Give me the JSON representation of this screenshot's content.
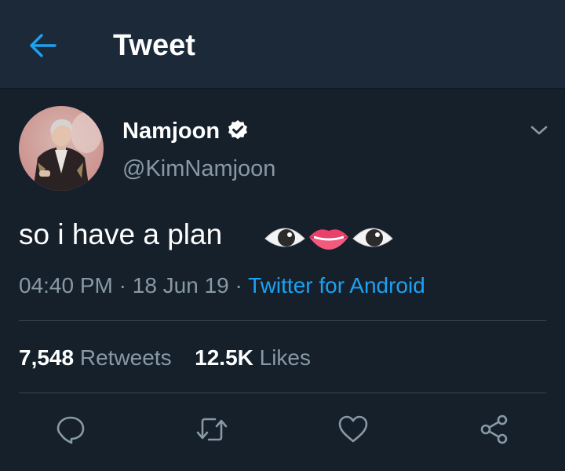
{
  "header": {
    "back_icon": "arrow-left-icon",
    "title": "Tweet"
  },
  "tweet": {
    "author": {
      "display_name": "Namjoon",
      "verified": true,
      "handle": "@KimNamjoon"
    },
    "text": "so i have a plan",
    "emojis": [
      "eye-emoji",
      "lips-emoji",
      "eye-emoji"
    ],
    "time": "04:40 PM",
    "sep1": "·",
    "date": "18 Jun 19",
    "sep2": "·",
    "source": "Twitter for Android",
    "stats": {
      "retweets_count": "7,548",
      "retweets_label": "Retweets",
      "likes_count": "12.5K",
      "likes_label": "Likes"
    },
    "actions": [
      "reply-icon",
      "retweet-icon",
      "like-icon",
      "share-icon"
    ]
  },
  "colors": {
    "background": "#15202b",
    "header_background": "#1c2938",
    "accent": "#1da1f2",
    "secondary_text": "#8899a6",
    "divider": "#38444d"
  }
}
